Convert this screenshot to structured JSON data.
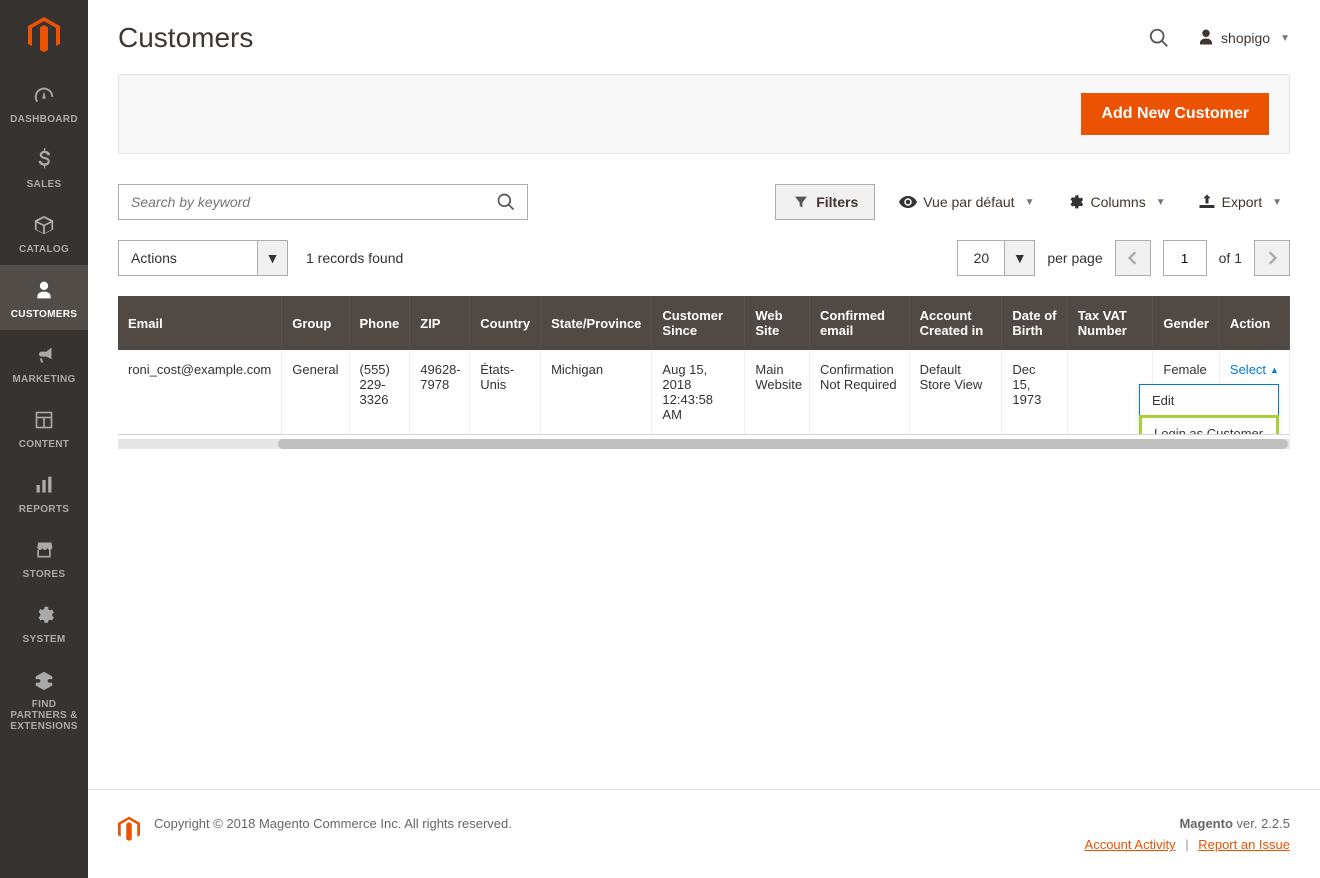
{
  "sidebar": {
    "items": [
      {
        "label": "DASHBOARD"
      },
      {
        "label": "SALES"
      },
      {
        "label": "CATALOG"
      },
      {
        "label": "CUSTOMERS"
      },
      {
        "label": "MARKETING"
      },
      {
        "label": "CONTENT"
      },
      {
        "label": "REPORTS"
      },
      {
        "label": "STORES"
      },
      {
        "label": "SYSTEM"
      },
      {
        "label": "FIND PARTNERS & EXTENSIONS"
      }
    ]
  },
  "header": {
    "title": "Customers",
    "user": "shopigo"
  },
  "topbar": {
    "add_button": "Add New Customer"
  },
  "controls": {
    "search_placeholder": "Search by keyword",
    "filters": "Filters",
    "default_view": "Vue par défaut",
    "columns": "Columns",
    "export": "Export"
  },
  "row2": {
    "actions": "Actions",
    "records_found": "1 records found",
    "per_page_value": "20",
    "per_page_label": "per page",
    "page_value": "1",
    "of_label": "of 1"
  },
  "table": {
    "headers": [
      "Email",
      "Group",
      "Phone",
      "ZIP",
      "Country",
      "State/Province",
      "Customer Since",
      "Web Site",
      "Confirmed email",
      "Account Created in",
      "Date of Birth",
      "Tax VAT Number",
      "Gender",
      "Action"
    ],
    "row": {
      "email": "roni_cost@example.com",
      "group": "General",
      "phone": "(555) 229-3326",
      "zip": "49628-7978",
      "country": "États-Unis",
      "state": "Michigan",
      "since": "Aug 15, 2018 12:43:58 AM",
      "website": "Main Website",
      "confirmed": "Confirmation Not Required",
      "created_in": "Default Store View",
      "dob": "Dec 15, 1973",
      "vat": "",
      "gender": "Female"
    },
    "action_select": "Select",
    "action_menu": {
      "edit": "Edit",
      "login_as": "Login as Customer"
    }
  },
  "footer": {
    "copyright": "Copyright © 2018 Magento Commerce Inc. All rights reserved.",
    "brand": "Magento",
    "version": " ver. 2.2.5",
    "account_activity": "Account Activity",
    "report_issue": "Report an Issue"
  }
}
